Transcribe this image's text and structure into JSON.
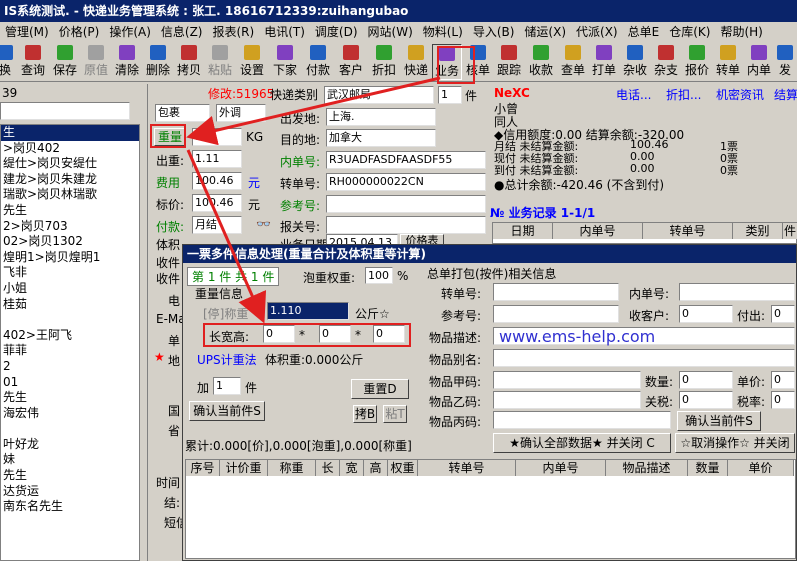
{
  "titlebar": {
    "text": "IS系统测试. - 快递业务管理系统 : 张工. 18616712339:zuihangubao"
  },
  "menu": [
    "管理(M)",
    "价格(P)",
    "操作(A)",
    "信息(Z)",
    "报表(R)",
    "电讯(T)",
    "调度(D)",
    "网站(W)",
    "物料(L)",
    "导入(B)",
    "储运(X)",
    "代派(X)",
    "总单E",
    "仓库(K)",
    "帮助(H)"
  ],
  "toolbar": [
    {
      "label": "换",
      "icon": "swap-icon"
    },
    {
      "label": "查询",
      "icon": "search-icon"
    },
    {
      "label": "保存",
      "icon": "save-icon"
    },
    {
      "label": "原值",
      "icon": "undo-icon",
      "disabled": true
    },
    {
      "label": "清除",
      "icon": "clear-icon"
    },
    {
      "label": "删除",
      "icon": "delete-icon"
    },
    {
      "label": "拷贝",
      "icon": "copy-icon"
    },
    {
      "label": "粘贴",
      "icon": "paste-icon",
      "disabled": true
    },
    {
      "label": "设置",
      "icon": "settings-icon"
    },
    {
      "label": "下家",
      "icon": "next-party-icon"
    },
    {
      "label": "付款",
      "icon": "payment-icon"
    },
    {
      "label": "客户",
      "icon": "customer-icon"
    },
    {
      "label": "折扣",
      "icon": "discount-icon"
    },
    {
      "label": "快递",
      "icon": "express-icon"
    },
    {
      "label": "业务",
      "icon": "business-icon",
      "active": true
    },
    {
      "label": "核单",
      "icon": "verify-icon"
    },
    {
      "label": "跟踪",
      "icon": "track-icon"
    },
    {
      "label": "收款",
      "icon": "receipt-icon"
    },
    {
      "label": "查单",
      "icon": "lookup-icon"
    },
    {
      "label": "打单",
      "icon": "print-icon"
    },
    {
      "label": "杂收",
      "icon": "misc-income-icon"
    },
    {
      "label": "杂支",
      "icon": "misc-expense-icon"
    },
    {
      "label": "报价",
      "icon": "quote-icon"
    },
    {
      "label": "转单",
      "icon": "transfer-icon"
    },
    {
      "label": "内单",
      "icon": "internal-icon"
    },
    {
      "label": "发",
      "icon": "send-icon"
    }
  ],
  "left_panel": {
    "top_value": "39",
    "items": [
      "生",
      ">岗贝402",
      "缇仕>岗贝安缇仕",
      "建龙>岗贝朱建龙",
      "瑞歌>岗贝林瑞歌",
      "先生",
      "2>岗贝703",
      "02>岗贝1302",
      "煌明1>岗贝煌明1",
      "飞非",
      "小姐",
      "桂茹",
      "",
      "402>王阿飞",
      "菲菲",
      "2",
      "01",
      "先生",
      "海宏伟",
      "",
      "叶好龙",
      "妹",
      "先生",
      "达货运",
      "南东名先生"
    ]
  },
  "form": {
    "modify_label": "修改:51965",
    "package_type": "包裹",
    "outgoing": "外调",
    "express_type_label": "快递类别",
    "express_type_value": "武汉邮局",
    "piece_count": "1",
    "piece_unit": "件",
    "weight_btn": "重量",
    "weight_value": "1.1",
    "kg": "KG",
    "charge_weight_label": "出重:",
    "charge_weight_value": "1.11",
    "fee_label": "费用",
    "fee_value": "100.46",
    "fee_unit": "元",
    "list_price_label": "标价:",
    "list_price_value": "100.46",
    "list_price_unit": "元",
    "payment_label": "付款:",
    "payment_value": "月结",
    "volume_label": "体积",
    "origin_label": "出发地:",
    "origin_value": "上海.",
    "dest_label": "目的地:",
    "dest_value": "加拿大",
    "inner_no_label": "内单号:",
    "inner_no_value": "R3UADFASDFAASDF55",
    "transfer_no_label": "转单号:",
    "transfer_no_value": "RH000000022CN",
    "ref_no_label": "参考号:",
    "customs_no_label": "报关号:",
    "biz_date_label": "业务日期",
    "biz_date_value": "2015.04.13",
    "check_btn": "价格表",
    "receive_label": "收件",
    "receiver_label": "收件",
    "tel_label": "电",
    "email_label": "E-Ma",
    "unit_label": "单",
    "addr_label": "地",
    "country_label": "国",
    "province_label": "省",
    "time_label": "时间",
    "settle_label": "结:",
    "short_label": "短信"
  },
  "right_info": {
    "nexc": "NeXC",
    "links": [
      "电话...",
      "折扣...",
      "机密资讯",
      "结算"
    ],
    "name": "小曾",
    "sub": "同人",
    "credit": "◆信用额度:0.00 结算余额:-320.00",
    "rows": [
      [
        "月结 未结算金额:",
        "100.46",
        "1票"
      ],
      [
        "现付 未结算金额:",
        "0.00",
        "0票"
      ],
      [
        "到付 未结算金额:",
        "0.00",
        "0票"
      ]
    ],
    "total": "●总计余额:-420.46 (不含到付)",
    "records_title": "№ 业务记录 1-1/1",
    "records_headers": [
      "日期",
      "内单号",
      "转单号",
      "类别",
      "件"
    ]
  },
  "dialog": {
    "title": "一票多件信息处理(重量合计及体积重等计算)",
    "tab_info": "第 1 件 共 1 件",
    "bubble_label": "泡重权重:",
    "bubble_value": "100",
    "bubble_unit": "%",
    "weight_info_label": "重量信息",
    "stop_label": "[停]称重",
    "weight_value": "1.110",
    "weight_unit": "公斤☆",
    "dims_label": "长宽高:",
    "dim_l": "0",
    "dim_w": "0",
    "dim_h": "0",
    "times": "*",
    "ups_label": "UPS计重法",
    "volume_weight": "体积重:0.000公斤",
    "add_label": "加",
    "add_value": "1",
    "add_unit": "件",
    "reset_btn": "重置D",
    "confirm_btn": "确认当前件S",
    "copy_btn": "拷B",
    "paste_btn": "粘T",
    "summary": "累计:0.000[价],0.000[泡重],0.000[称重]",
    "confirm_all_btn": "★确认全部数据★ 并关闭 C",
    "cancel_btn": "☆取消操作☆ 并关闭",
    "pack_title": "总单打包(按件)相关信息",
    "pack_fields": {
      "transfer_no": "转单号:",
      "inner_no": "内单号:",
      "ref_no": "参考号:",
      "recv_customer": "收客户:",
      "recv_customer_value": "0",
      "pay_out": "付出:",
      "pay_out_value": "0",
      "desc": "物品描述:",
      "alias": "物品别名:",
      "item_a": "物品甲码:",
      "item_b": "物品乙码:",
      "item_c": "物品丙码:",
      "qty": "数量:",
      "qty_value": "0",
      "unit_price": "单价:",
      "unit_price_value": "0",
      "tariff": "关税:",
      "tariff_value": "0",
      "tax_rate": "税率:",
      "tax_rate_value": "0",
      "confirm_btn": "确认当前件S"
    },
    "watermark": "www.ems-help.com",
    "table_headers": [
      "序号",
      "计价重",
      "称重",
      "长",
      "宽",
      "高",
      "权重",
      "转单号",
      "内单号",
      "物品描述",
      "数量",
      "单价"
    ]
  }
}
